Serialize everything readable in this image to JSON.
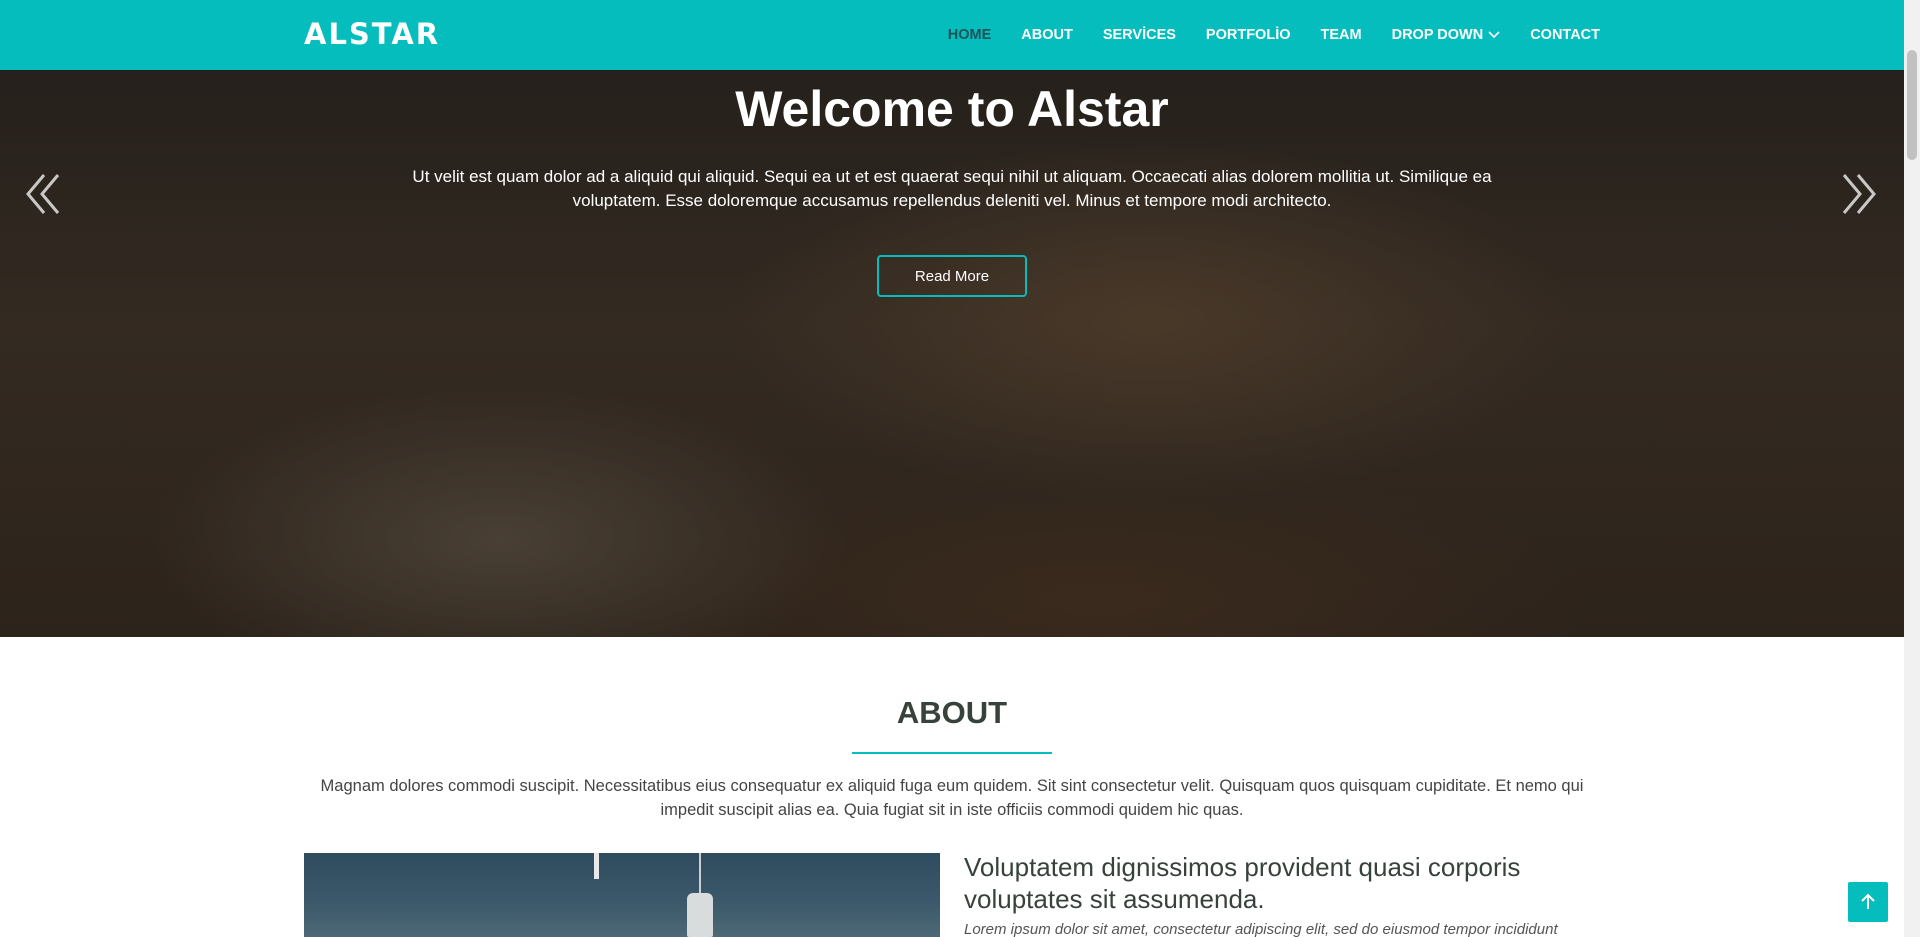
{
  "header": {
    "logo": "ALSTAR",
    "nav": [
      {
        "label": "HOME",
        "active": true
      },
      {
        "label": "ABOUT"
      },
      {
        "label": "SERVİCES"
      },
      {
        "label": "PORTFOLİO"
      },
      {
        "label": "TEAM"
      },
      {
        "label": "DROP DOWN",
        "has_dropdown": true
      },
      {
        "label": "CONTACT"
      }
    ]
  },
  "hero": {
    "title": "Welcome to Alstar",
    "text": "Ut velit est quam dolor ad a aliquid qui aliquid. Sequi ea ut et est quaerat sequi nihil ut aliquam. Occaecati alias dolorem mollitia ut. Similique ea voluptatem. Esse doloremque accusamus repellendus deleniti vel. Minus et tempore modi architecto.",
    "button": "Read More",
    "prev_icon": "double-chevron-left-icon",
    "next_icon": "double-chevron-right-icon"
  },
  "about": {
    "title": "ABOUT",
    "text": "Magnam dolores commodi suscipit. Necessitatibus eius consequatur ex aliquid fuga eum quidem. Sit sint consectetur velit. Quisquam quos quisquam cupiditate. Et nemo qui impedit suscipit alias ea. Quia fugiat sit in iste officiis commodi quidem hic quas.",
    "heading": "Voluptatem dignissimos provident quasi corporis voluptates sit assumenda.",
    "italic": "Lorem ipsum dolor sit amet, consectetur adipiscing elit, sed do eiusmod tempor incididunt"
  },
  "back_to_top_icon": "arrow-up-icon",
  "colors": {
    "accent": "#05bdbd",
    "active_nav": "#1d5258",
    "heading": "#37423b"
  }
}
